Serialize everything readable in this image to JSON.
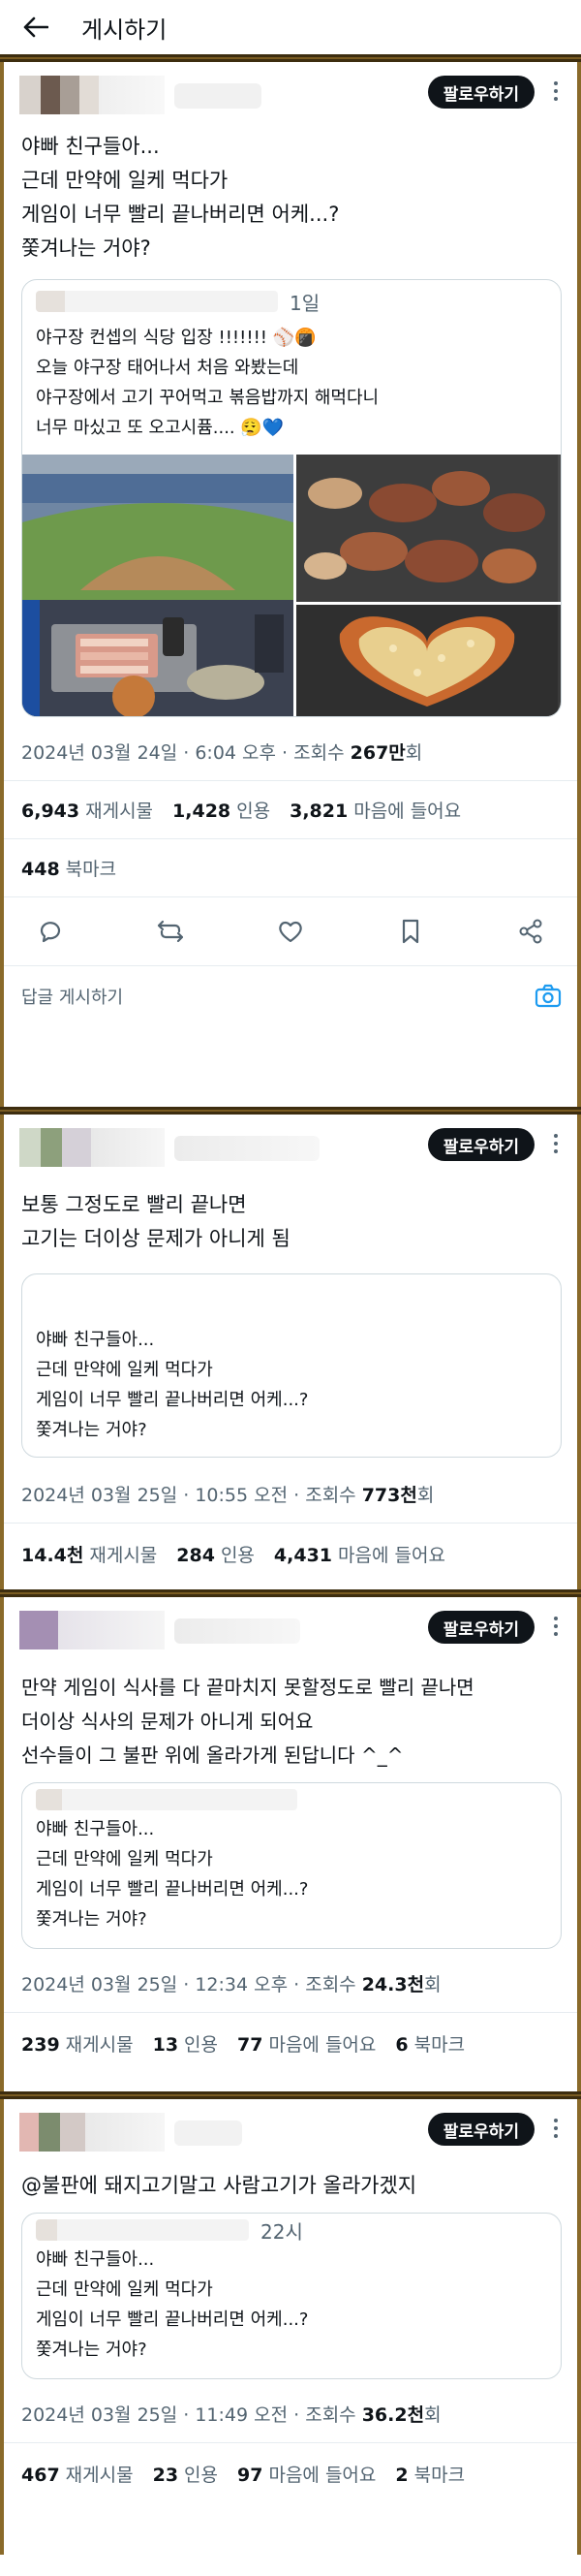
{
  "header": {
    "title": "게시하기"
  },
  "colors": {
    "accent": "#1d9bf0",
    "follow_bg": "#0f1419",
    "muted": "#536471",
    "separator": "#7a5c22"
  },
  "posts": [
    {
      "follow_label": "팔로우하기",
      "text_lines": [
        "야빠 친구들아...",
        "근데 만약에 일케 먹다가",
        "게임이 너무 빨리 끝나버리면 어케...?",
        "쫓겨나는 거야?"
      ],
      "quote": {
        "time": "1일",
        "lines": [
          "야구장 컨셉의 식당 입장 !!!!!!! ⚾🍘",
          "오늘 야구장 태어나서 처음 와봤는데",
          "야구장에서 고기 꾸어먹고 볶음밥까지 해먹다니",
          "너무 마싰고 또 오고시퓸.... 😮‍💨💙"
        ]
      },
      "meta": {
        "date": "2024년 03월 24일 · 6:04 오후 · 조회수 ",
        "views": "267만",
        "views_suffix": "회"
      },
      "stats": [
        {
          "num": "6,943",
          "label": "재게시물"
        },
        {
          "num": "1,428",
          "label": "인용"
        },
        {
          "num": "3,821",
          "label": "마음에 들어요"
        }
      ],
      "bookmarks": {
        "num": "448",
        "label": "북마크"
      },
      "reply_placeholder": "답글 게시하기"
    },
    {
      "follow_label": "팔로우하기",
      "text_lines": [
        "보통 그정도로 빨리 끝나면",
        "고기는 더이상 문제가 아니게 됨"
      ],
      "quote": {
        "lines": [
          "야빠 친구들아...",
          "근데 만약에 일케 먹다가",
          "게임이 너무 빨리 끝나버리면 어케...?",
          "쫓겨나는 거야?"
        ]
      },
      "meta": {
        "date": "2024년 03월 25일 · 10:55 오전 · 조회수 ",
        "views": "773천",
        "views_suffix": "회"
      },
      "stats": [
        {
          "num": "14.4천",
          "label": "재게시물"
        },
        {
          "num": "284",
          "label": "인용"
        },
        {
          "num": "4,431",
          "label": "마음에 들어요"
        }
      ]
    },
    {
      "follow_label": "팔로우하기",
      "text_lines": [
        "만약 게임이 식사를 다 끝마치지 못할정도로 빨리 끝나면",
        "더이상 식사의 문제가 아니게 되어요",
        "선수들이 그 불판 위에 올라가게 된답니다 ^_^"
      ],
      "quote": {
        "lines": [
          "야빠 친구들아...",
          "근데 만약에 일케 먹다가",
          "게임이 너무 빨리 끝나버리면 어케...?",
          "쫓겨나는 거야?"
        ]
      },
      "meta": {
        "date": "2024년 03월 25일 · 12:34 오후 · 조회수 ",
        "views": "24.3천",
        "views_suffix": "회"
      },
      "stats": [
        {
          "num": "239",
          "label": "재게시물"
        },
        {
          "num": "13",
          "label": "인용"
        },
        {
          "num": "77",
          "label": "마음에 들어요"
        },
        {
          "num": "6",
          "label": "북마크"
        }
      ]
    },
    {
      "follow_label": "팔로우하기",
      "text_lines": [
        "@불판에 돼지고기말고 사람고기가 올라가겠지"
      ],
      "quote": {
        "time": "22시",
        "lines": [
          "야빠 친구들아...",
          "근데 만약에 일케 먹다가",
          "게임이 너무 빨리 끝나버리면 어케...?",
          "쫓겨나는 거야?"
        ]
      },
      "meta": {
        "date": "2024년 03월 25일 · 11:49 오전 · 조회수 ",
        "views": "36.2천",
        "views_suffix": "회"
      },
      "stats": [
        {
          "num": "467",
          "label": "재게시물"
        },
        {
          "num": "23",
          "label": "인용"
        },
        {
          "num": "97",
          "label": "마음에 들어요"
        },
        {
          "num": "2",
          "label": "북마크"
        }
      ]
    }
  ]
}
